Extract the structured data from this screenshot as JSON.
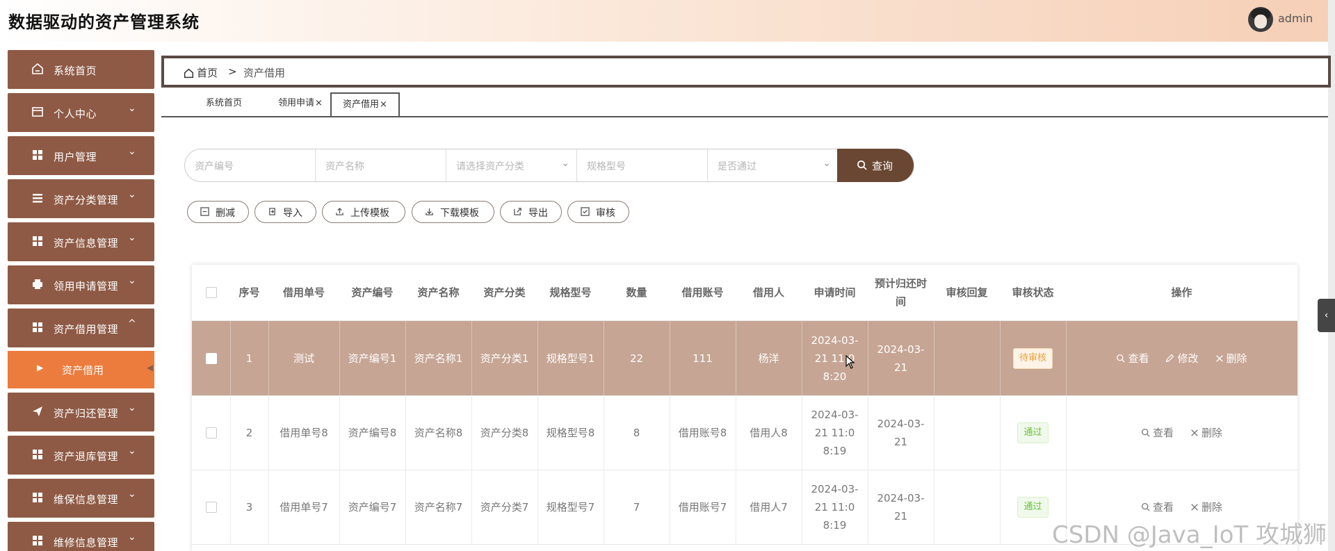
{
  "app": {
    "title": "数据驱动的资产管理系统",
    "user": "admin"
  },
  "sidebar": {
    "items": [
      {
        "label": "系统首页",
        "icon": "home-icon"
      },
      {
        "label": "个人中心",
        "icon": "card-icon"
      },
      {
        "label": "用户管理",
        "icon": "grid-icon"
      },
      {
        "label": "资产分类管理",
        "icon": "list-icon"
      },
      {
        "label": "资产信息管理",
        "icon": "grid-icon"
      },
      {
        "label": "领用申请管理",
        "icon": "printer-icon"
      },
      {
        "label": "资产借用管理",
        "icon": "grid-icon"
      },
      {
        "label": "资产借用",
        "icon": "caret-right-icon"
      },
      {
        "label": "资产归还管理",
        "icon": "send-icon"
      },
      {
        "label": "资产退库管理",
        "icon": "grid-icon"
      },
      {
        "label": "维保信息管理",
        "icon": "grid-icon"
      },
      {
        "label": "维修信息管理",
        "icon": "grid-icon"
      }
    ]
  },
  "breadcrumb": {
    "home": "首页",
    "sep": ">",
    "current": "资产借用"
  },
  "tabs": [
    {
      "label": "系统首页"
    },
    {
      "label": "领用申请",
      "close": "×"
    },
    {
      "label": "资产借用",
      "close": "×"
    }
  ],
  "search": {
    "asset_code": "资产编号",
    "asset_name": "资产名称",
    "asset_category": "请选择资产分类",
    "spec_model": "规格型号",
    "passed": "是否通过",
    "button": "查询"
  },
  "actions": {
    "delete": "删减",
    "import": "导入",
    "upload_template": "上传模板",
    "download_template": "下载模板",
    "export": "导出",
    "audit": "审核"
  },
  "table": {
    "headers": {
      "index": "序号",
      "borrow_no": "借用单号",
      "asset_code": "资产编号",
      "asset_name": "资产名称",
      "asset_category": "资产分类",
      "spec": "规格型号",
      "quantity": "数量",
      "account": "借用账号",
      "borrower": "借用人",
      "apply_time": "申请时间",
      "return_time": "预计归还时间",
      "audit_reply": "审核回复",
      "audit_status": "审核状态",
      "ops": "操作"
    },
    "rows": [
      {
        "index": "1",
        "borrow_no": "测试",
        "asset_code": "资产编号1",
        "asset_name": "资产名称1",
        "asset_category": "资产分类1",
        "spec": "规格型号1",
        "quantity": "22",
        "account": "111",
        "borrower": "杨洋",
        "apply_time": "2024-03-21 11:08:20",
        "return_time": "2024-03-21",
        "audit_reply": "",
        "audit_status": "待审核",
        "ops": [
          "查看",
          "修改",
          "删除"
        ]
      },
      {
        "index": "2",
        "borrow_no": "借用单号8",
        "asset_code": "资产编号8",
        "asset_name": "资产名称8",
        "asset_category": "资产分类8",
        "spec": "规格型号8",
        "quantity": "8",
        "account": "借用账号8",
        "borrower": "借用人8",
        "apply_time": "2024-03-21 11:08:19",
        "return_time": "2024-03-21",
        "audit_reply": "",
        "audit_status": "通过",
        "ops": [
          "查看",
          "删除"
        ]
      },
      {
        "index": "3",
        "borrow_no": "借用单号7",
        "asset_code": "资产编号7",
        "asset_name": "资产名称7",
        "asset_category": "资产分类7",
        "spec": "规格型号7",
        "quantity": "7",
        "account": "借用账号7",
        "borrower": "借用人7",
        "apply_time": "2024-03-21 11:08:19",
        "return_time": "2024-03-21",
        "audit_reply": "",
        "audit_status": "通过",
        "ops": [
          "查看",
          "删除"
        ]
      }
    ]
  },
  "watermark": "CSDN @Java_IoT 攻城狮",
  "colors": {
    "sidebar": "#8e5a45",
    "sidebar_active": "#ec7c3d",
    "selected_row": "#c6a594",
    "search_button": "#6a4733"
  }
}
